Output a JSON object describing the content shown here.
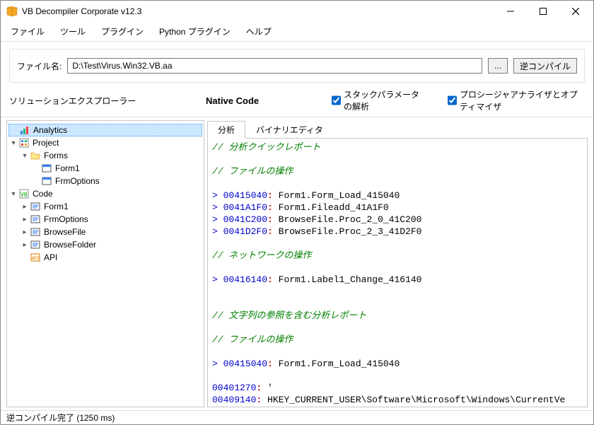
{
  "window": {
    "title": "VB Decompiler Corporate v12.3"
  },
  "menu": {
    "file": "ファイル",
    "tools": "ツール",
    "plugins": "プラグイン",
    "python_plugins": "Python プラグイン",
    "help": "ヘルプ"
  },
  "toolbar": {
    "file_label": "ファイル名:",
    "file_path": "D:\\Test\\Virus.Win32.VB.aa",
    "browse": "...",
    "decompile": "逆コンパイル"
  },
  "subbar": {
    "explorer_label": "ソリューションエクスプローラー",
    "native_code": "Native Code",
    "stack_params": "スタックパラメータの解析",
    "proc_analyzer": "プロシージャアナライザとオプティマイザ"
  },
  "tree": {
    "analytics": "Analytics",
    "project": "Project",
    "forms": "Forms",
    "form1_a": "Form1",
    "frmoptions_a": "FrmOptions",
    "code": "Code",
    "form1_b": "Form1",
    "frmoptions_b": "FrmOptions",
    "browsefile": "BrowseFile",
    "browsefolder": "BrowseFolder",
    "api": "API"
  },
  "tabs": {
    "analysis": "分析",
    "binary_editor": "バイナリエディタ"
  },
  "code_lines": [
    {
      "kind": "comment",
      "text": "// 分析クイックレポート"
    },
    {
      "kind": "blank"
    },
    {
      "kind": "comment",
      "text": "// ファイルの操作"
    },
    {
      "kind": "blank"
    },
    {
      "kind": "entry",
      "addr": "00415040",
      "name": "Form1.Form_Load_415040"
    },
    {
      "kind": "entry",
      "addr": "0041A1F0",
      "name": "Form1.Fileadd_41A1F0"
    },
    {
      "kind": "entry",
      "addr": "0041C200",
      "name": "BrowseFile.Proc_2_0_41C200"
    },
    {
      "kind": "entry",
      "addr": "0041D2F0",
      "name": "BrowseFile.Proc_2_3_41D2F0"
    },
    {
      "kind": "blank"
    },
    {
      "kind": "comment",
      "text": "// ネットワークの操作"
    },
    {
      "kind": "blank"
    },
    {
      "kind": "entry",
      "addr": "00416140",
      "name": "Form1.Label1_Change_416140"
    },
    {
      "kind": "blank"
    },
    {
      "kind": "blank"
    },
    {
      "kind": "comment",
      "text": "// 文字列の参照を含む分析レポート"
    },
    {
      "kind": "blank"
    },
    {
      "kind": "comment",
      "text": "// ファイルの操作"
    },
    {
      "kind": "blank"
    },
    {
      "kind": "entry",
      "addr": "00415040",
      "name": "Form1.Form_Load_415040"
    },
    {
      "kind": "blank"
    },
    {
      "kind": "string",
      "addr": "00401270",
      "value": "'"
    },
    {
      "kind": "string",
      "addr": "00409140",
      "value": "HKEY_CURRENT_USER\\Software\\Microsoft\\Windows\\CurrentVe"
    }
  ],
  "status": {
    "text": "逆コンパイル完了 (1250 ms)"
  }
}
